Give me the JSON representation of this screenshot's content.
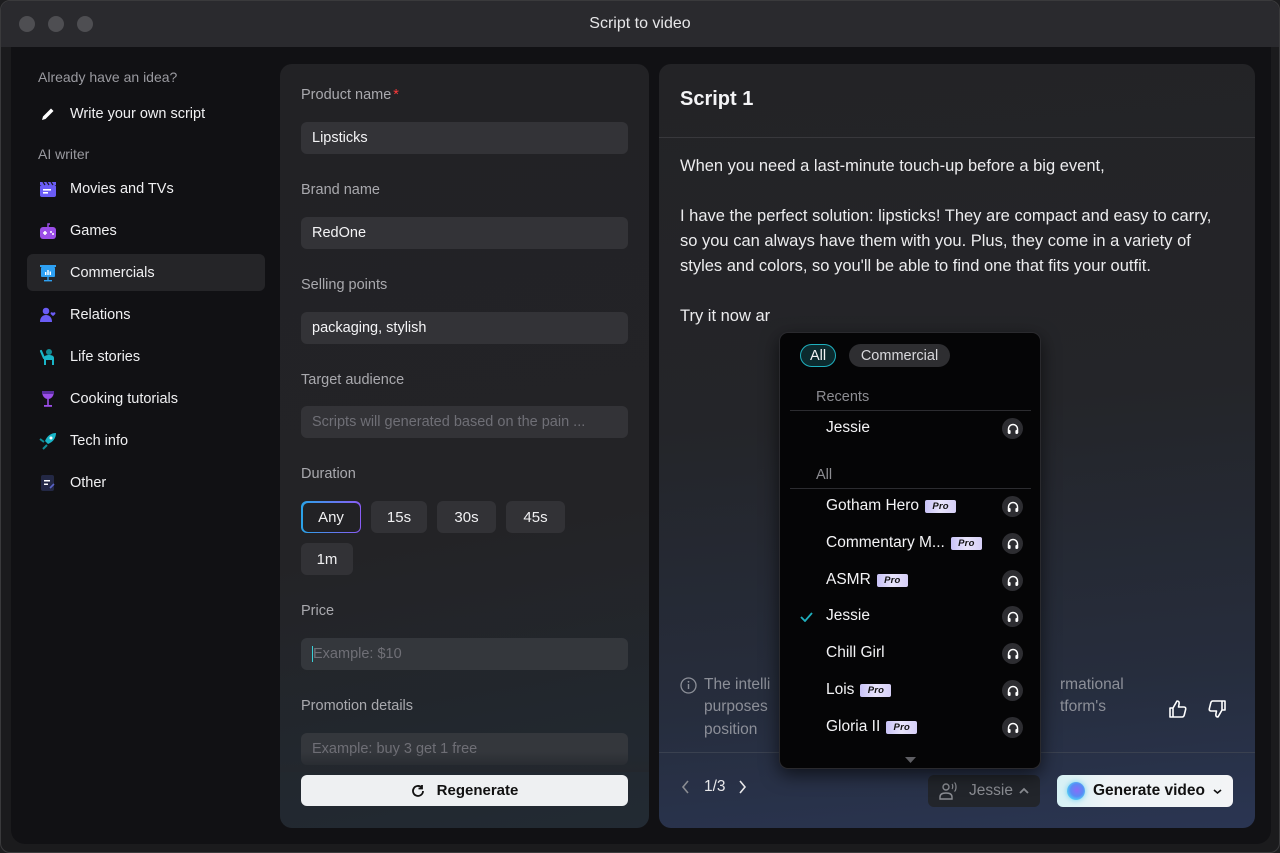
{
  "window": {
    "title": "Script to video"
  },
  "sidebar": {
    "own_heading": "Already have an idea?",
    "write_own": "Write your own script",
    "ai_heading": "AI writer",
    "items": [
      {
        "label": "Movies and TVs",
        "icon": "clapperboard-icon",
        "color": "#6a5cf5"
      },
      {
        "label": "Games",
        "icon": "gamepad-icon",
        "color": "#9b4ee8"
      },
      {
        "label": "Commercials",
        "icon": "presentation-board-icon",
        "color": "#2ea0f2",
        "active": true
      },
      {
        "label": "Relations",
        "icon": "person-heart-icon",
        "color": "#6a5cf5"
      },
      {
        "label": "Life stories",
        "icon": "person-waving-icon",
        "color": "#19b6c8"
      },
      {
        "label": "Cooking tutorials",
        "icon": "wine-glass-icon",
        "color": "#9b4ee8"
      },
      {
        "label": "Tech info",
        "icon": "rocket-icon",
        "color": "#19b6c8"
      },
      {
        "label": "Other",
        "icon": "note-edit-icon",
        "color": "#2a2f52"
      }
    ]
  },
  "form": {
    "product_label": "Product name",
    "product_required": "*",
    "product_value": "Lipsticks",
    "brand_label": "Brand name",
    "brand_value": "RedOne",
    "selling_label": "Selling points",
    "selling_value": "packaging, stylish",
    "audience_label": "Target audience",
    "audience_placeholder": "Scripts will generated based on the pain ...",
    "duration_label": "Duration",
    "durations": [
      "Any",
      "15s",
      "30s",
      "45s",
      "1m"
    ],
    "duration_selected": "Any",
    "price_label": "Price",
    "price_placeholder": "Example: $10",
    "promo_label": "Promotion details",
    "promo_placeholder": "Example: buy 3 get 1 free",
    "regenerate_label": "Regenerate"
  },
  "script": {
    "title": "Script 1",
    "paragraphs": [
      "When you need a last-minute touch-up before a big event,",
      "I have the perfect solution: lipsticks! They are compact and easy to carry, so you can always have them with you. Plus, they come in a variety of styles and colors, so you'll be able to find one that fits your outfit.",
      "Try it now ar"
    ],
    "disclaimer_left": "The intelli",
    "disclaimer_left2": "purposes",
    "disclaimer_left3": "position",
    "disclaimer_right": "rmational",
    "disclaimer_right2": "tform's",
    "pager": "1/3",
    "voice_label": "Jessie",
    "generate_label": "Generate video"
  },
  "voice_dropdown": {
    "filters": [
      "All",
      "Commercial"
    ],
    "active_filter": "All",
    "recents_heading": "Recents",
    "recents": [
      {
        "name": "Jessie",
        "pro": false
      }
    ],
    "all_heading": "All",
    "voices": [
      {
        "name": "Gotham Hero",
        "pro": true,
        "selected": false
      },
      {
        "name": "Commentary M...",
        "pro": true,
        "selected": false
      },
      {
        "name": "ASMR",
        "pro": true,
        "selected": false
      },
      {
        "name": "Jessie",
        "pro": false,
        "selected": true
      },
      {
        "name": "Chill Girl",
        "pro": false,
        "selected": false
      },
      {
        "name": "Lois",
        "pro": true,
        "selected": false
      },
      {
        "name": "Gloria II",
        "pro": true,
        "selected": false
      }
    ],
    "pro_badge": "Pro",
    "accent": "#1fb0be"
  }
}
